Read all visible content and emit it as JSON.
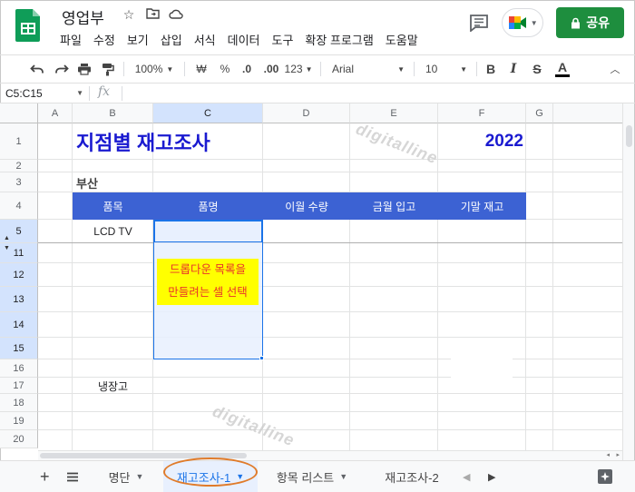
{
  "app": {
    "doc_title": "영업부"
  },
  "menu": [
    "파일",
    "수정",
    "보기",
    "삽입",
    "서식",
    "데이터",
    "도구",
    "확장 프로그램",
    "도움말"
  ],
  "share_label": "공유",
  "toolbar": {
    "zoom": "100%",
    "currency": "₩",
    "percent": "%",
    "dec_less": ".0",
    "dec_more": ".00",
    "format_123": "123",
    "font": "Arial",
    "font_size": "10"
  },
  "formula_bar": {
    "name_box": "C5:C15",
    "fx": "fx"
  },
  "columns": [
    "A",
    "B",
    "C",
    "D",
    "E",
    "F",
    "G"
  ],
  "rows": [
    "1",
    "2",
    "3",
    "4",
    "5",
    "11",
    "12",
    "13",
    "14",
    "15",
    "16",
    "17",
    "18",
    "19",
    "20"
  ],
  "sheet": {
    "title": "지점별 재고조사",
    "year": "2022",
    "branch": "부산",
    "headers": [
      "품목",
      "품명",
      "이월 수량",
      "금월 입고",
      "기말 재고"
    ],
    "item_1": "LCD TV",
    "item_2": "냉장고",
    "note_line1": "드롭다운 목록을",
    "note_line2": "만들려는 셀 선택"
  },
  "watermark": "digitalline",
  "tabs": [
    "명단",
    "재고조사-1",
    "항목 리스트",
    "재고조사-2"
  ],
  "colors": {
    "header_blue": "#3c62d3",
    "title_blue": "#1a1ad0",
    "note_yellow": "#ffff00",
    "note_red": "#e8332a",
    "share_green": "#1e8e3e",
    "oval_orange": "#e07b2a"
  }
}
